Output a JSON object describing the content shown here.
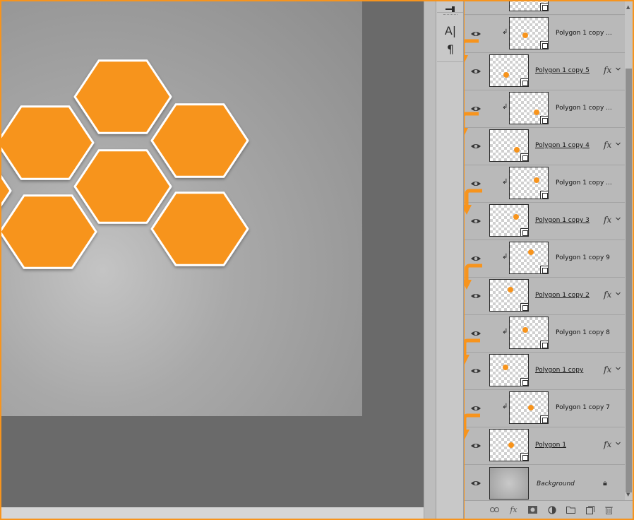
{
  "canvas": {
    "artboard_gradient": [
      "#c4c4c4",
      "#8c8c8c"
    ],
    "shape_color": "#f7941d",
    "stroke_color": "#ffffff",
    "hexagon_count": 7
  },
  "tools": {
    "items": [
      {
        "name": "type-tool-icon",
        "glyph": "A|"
      },
      {
        "name": "paragraph-icon",
        "glyph": "¶"
      }
    ]
  },
  "layers": {
    "rows": [
      {
        "kind": "clipped",
        "name": "Polygon 1 copy ..."
      },
      {
        "kind": "parent",
        "name": "Polygon 1 copy 5",
        "fx": "fx"
      },
      {
        "kind": "clipped",
        "name": "Polygon 1 copy ..."
      },
      {
        "kind": "parent",
        "name": "Polygon 1 copy 4",
        "fx": "fx"
      },
      {
        "kind": "clipped",
        "name": "Polygon 1 copy ..."
      },
      {
        "kind": "parent",
        "name": "Polygon 1 copy 3",
        "fx": "fx"
      },
      {
        "kind": "clipped",
        "name": "Polygon 1 copy 9"
      },
      {
        "kind": "parent",
        "name": "Polygon 1 copy 2",
        "fx": "fx"
      },
      {
        "kind": "clipped",
        "name": "Polygon 1 copy 8"
      },
      {
        "kind": "parent",
        "name": "Polygon 1 copy",
        "fx": "fx"
      },
      {
        "kind": "clipped",
        "name": "Polygon 1 copy 7"
      },
      {
        "kind": "parent",
        "name": "Polygon 1",
        "fx": "fx"
      },
      {
        "kind": "background",
        "name": "Background"
      }
    ]
  },
  "footer": {
    "icons": [
      "link-icon",
      "fx-icon",
      "mask-icon",
      "adjustment-icon",
      "folder-icon",
      "new-layer-icon",
      "trash-icon"
    ],
    "fx_glyph": "fx"
  },
  "accent_color": "#f7941d"
}
